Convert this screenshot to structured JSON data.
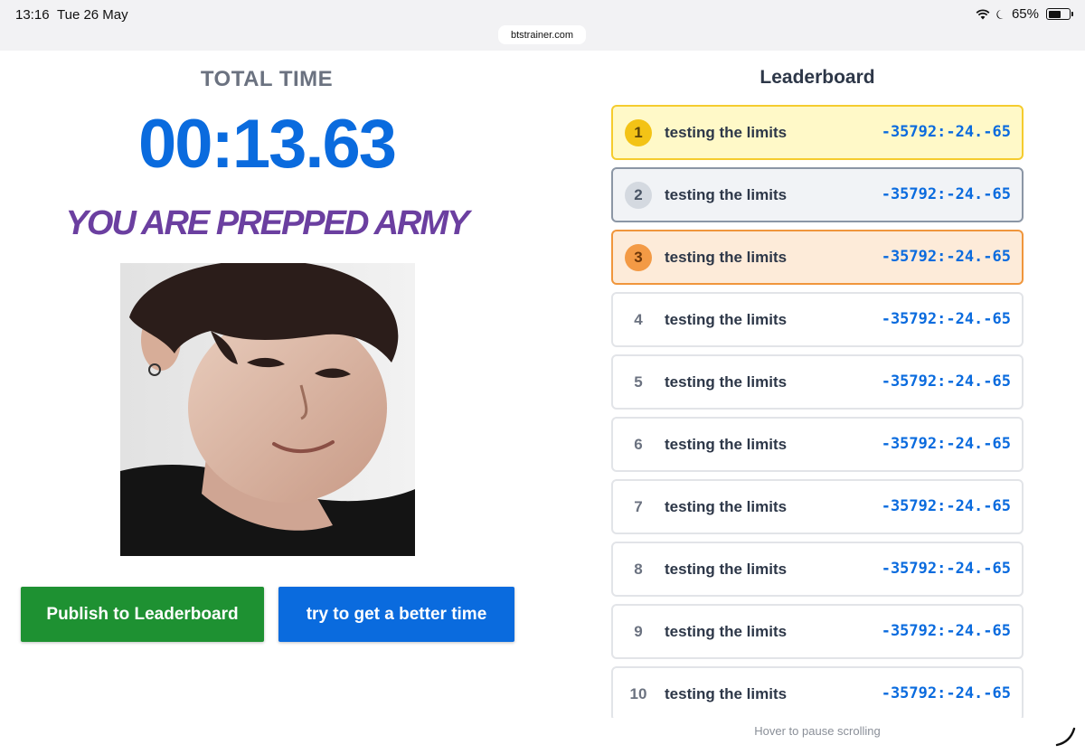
{
  "status": {
    "time": "13:16",
    "date": "Tue 26 May",
    "battery_pct": "65%",
    "battery_level": 0.65
  },
  "browser": {
    "url": "btstrainer.com"
  },
  "results": {
    "label": "TOTAL TIME",
    "time": "00:13.63",
    "message": "YOU ARE PREPPED ARMY",
    "publish_label": "Publish to Leaderboard",
    "retry_label": "try to get a better time"
  },
  "leaderboard": {
    "title": "Leaderboard",
    "rows": [
      {
        "rank": "1",
        "name": "testing the limits",
        "score": "-35792:-24.-65"
      },
      {
        "rank": "2",
        "name": "testing the limits",
        "score": "-35792:-24.-65"
      },
      {
        "rank": "3",
        "name": "testing the limits",
        "score": "-35792:-24.-65"
      },
      {
        "rank": "4",
        "name": "testing the limits",
        "score": "-35792:-24.-65"
      },
      {
        "rank": "5",
        "name": "testing the limits",
        "score": "-35792:-24.-65"
      },
      {
        "rank": "6",
        "name": "testing the limits",
        "score": "-35792:-24.-65"
      },
      {
        "rank": "7",
        "name": "testing the limits",
        "score": "-35792:-24.-65"
      },
      {
        "rank": "8",
        "name": "testing the limits",
        "score": "-35792:-24.-65"
      },
      {
        "rank": "9",
        "name": "testing the limits",
        "score": "-35792:-24.-65"
      },
      {
        "rank": "10",
        "name": "testing the limits",
        "score": "-35792:-24.-65"
      }
    ],
    "hint": "Hover to pause scrolling"
  },
  "colors": {
    "accent_blue": "#0a6bde",
    "publish_green": "#1e9132",
    "headline_purple": "#6b3fa0",
    "gold": "#f3c316",
    "silver": "#d4d9e0",
    "bronze": "#f39a45"
  }
}
